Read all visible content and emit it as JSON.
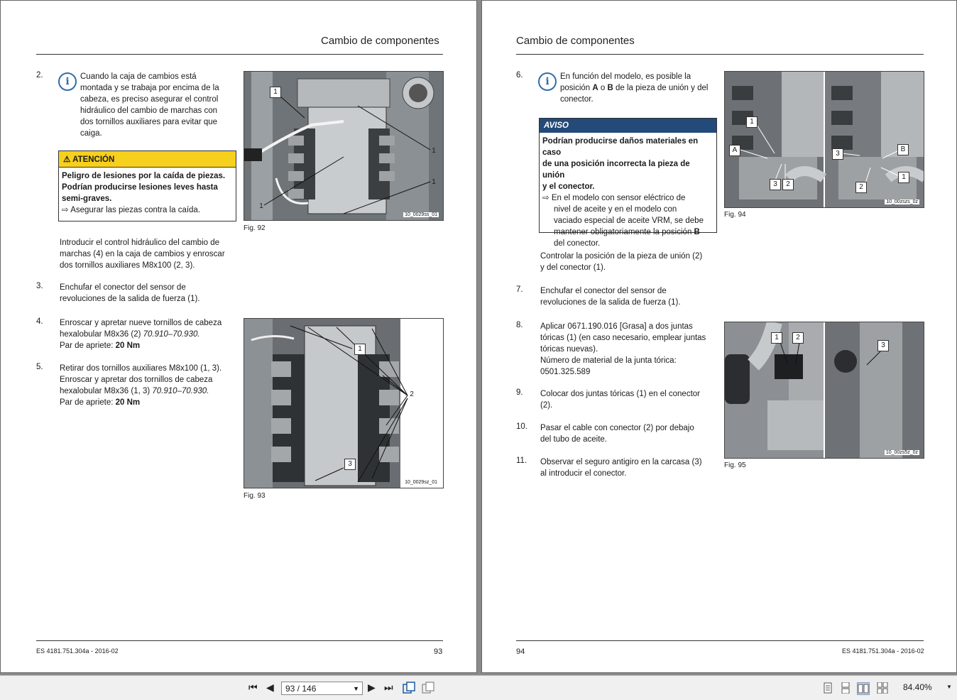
{
  "left_page": {
    "header_title": "Cambio de componentes",
    "step2": {
      "num": "2.",
      "info_lines": [
        "Cuando la caja de cambios está",
        "montada y se trabaja por encima de la",
        "cabeza, es preciso asegurar el control",
        "hidráulico del cambio de marchas con",
        "dos tornillos auxiliares para evitar que",
        "caiga."
      ],
      "warning_title": "ATENCIÓN",
      "warning_lines": [
        "Peligro de lesiones por la caída de piezas.",
        "Podrían producirse lesiones leves hasta",
        "semi-graves."
      ],
      "warning_action": "Asegurar las piezas contra la caída.",
      "body_lines": [
        "Introducir el control hidráulico del cambio de",
        "marchas (4) en la caja de cambios y enroscar",
        "dos tornillos auxiliares M8x100 (2, 3)."
      ]
    },
    "step3": {
      "num": "3.",
      "lines": [
        "Enchufar el conector del sensor de",
        "revoluciones de la salida de fuerza (1)."
      ]
    },
    "step4": {
      "num": "4.",
      "line1": "Enroscar y apretar nueve tornillos de cabeza",
      "line2": "hexalobular M8x36 (2) ",
      "line2_ref": "70.910–70.930.",
      "torque_label": "Par de apriete: ",
      "torque_value": "20 Nm"
    },
    "step5": {
      "num": "5.",
      "line1": "Retirar dos tornillos auxiliares M8x100 (1, 3).",
      "line2": "Enroscar y apretar dos tornillos de cabeza",
      "line3": "hexalobular M8x36 (1, 3) ",
      "line3_ref": "70.910–70.930.",
      "torque_label": "Par de apriete: ",
      "torque_value": "20 Nm"
    },
    "fig92": {
      "caption": "Fig. 92",
      "code": "10_0029ss_01",
      "callouts": [
        "1",
        "1",
        "1",
        "1"
      ]
    },
    "fig93": {
      "caption": "Fig. 93",
      "code": "10_0029sz_01",
      "callouts": [
        "1",
        "2",
        "3"
      ]
    },
    "footer_doc": "ES 4181.751.304a - 2016-02",
    "footer_page": "93"
  },
  "right_page": {
    "header_title": "Cambio de componentes",
    "step6": {
      "num": "6.",
      "info_line1": "En función del modelo, es posible la",
      "info_line2_a": "posición ",
      "info_pos_a": "A",
      "info_line2_o": " o ",
      "info_pos_b": "B",
      "info_line2_rest": " de la pieza de unión y del",
      "info_line3": "conector.",
      "notice_title": "AVISO",
      "notice_lines": [
        "Podrían producirse daños materiales en caso",
        "de una posición incorrecta la pieza de unión",
        "y el conector."
      ],
      "notice_action_lines": [
        "En el modelo con sensor eléctrico de",
        "nivel de aceite y en el modelo con",
        "vaciado especial de aceite VRM, se debe"
      ],
      "notice_action_last": "mantener obligatoriamente la posición ",
      "notice_action_pos": "B",
      "notice_action_end": "del conector.",
      "body_lines": [
        "Controlar la posición de la pieza de unión (2)",
        "y del conector (1)."
      ]
    },
    "step7": {
      "num": "7.",
      "lines": [
        "Enchufar el conector del sensor de",
        "revoluciones de la salida de fuerza (1)."
      ]
    },
    "step8": {
      "num": "8.",
      "lines": [
        "Aplicar 0671.190.016 [Grasa] a dos juntas",
        "tóricas (1) (en caso necesario, emplear juntas",
        "tóricas nuevas).",
        "Número de material de la junta tórica:",
        "0501.325.589"
      ]
    },
    "step9": {
      "num": "9.",
      "lines": [
        "Colocar dos juntas tóricas (1) en el conector",
        "(2)."
      ]
    },
    "step10": {
      "num": "10.",
      "lines": [
        "Pasar el cable con conector (2) por debajo",
        "del tubo de aceite."
      ]
    },
    "step11": {
      "num": "11.",
      "lines": [
        "Observar el seguro antigiro en la carcasa (3)",
        "al introducir el conector."
      ]
    },
    "fig94": {
      "caption": "Fig. 94",
      "code": "10_00zszs_0z",
      "callouts_left": [
        "1",
        "A",
        "3",
        "2"
      ],
      "callouts_right": [
        "3",
        "B",
        "2",
        "1"
      ]
    },
    "fig95": {
      "caption": "Fig. 95",
      "code": "10_00zs5z_0z",
      "callouts": [
        "1",
        "2",
        "3"
      ]
    },
    "footer_page": "94",
    "footer_doc": "ES 4181.751.304a - 2016-02"
  },
  "toolbar": {
    "page_display": "93 / 146",
    "zoom": "84.40%"
  },
  "colors": {
    "warning_yellow": "#f7cf1d",
    "notice_blue": "#234a78",
    "info_blue": "#2d6ea8",
    "viewer_bg": "#8a8a8a"
  }
}
